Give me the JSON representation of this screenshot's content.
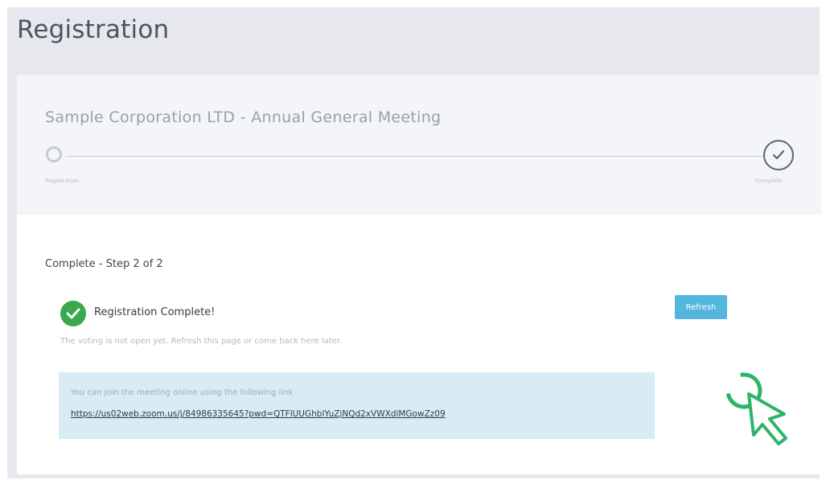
{
  "page": {
    "title": "Registration"
  },
  "meeting": {
    "title": "Sample Corporation LTD - Annual General Meeting"
  },
  "stepper": {
    "steps": [
      {
        "label": "Registration",
        "state": "inactive"
      },
      {
        "label": "Complete",
        "state": "active"
      }
    ]
  },
  "status": {
    "step_text": "Complete - Step 2 of 2",
    "complete_title": "Registration Complete!",
    "voting_note": "The voting is not open yet. Refresh this page or come back here later."
  },
  "refresh_button": {
    "label": "Refresh"
  },
  "info_box": {
    "text": "You can join the meeting online using the following link",
    "link": "https://us02web.zoom.us/j/84986335645?pwd=QTFlUUGhblYuZjNQd2xVWXdlMGowZz09"
  },
  "colors": {
    "accent_button": "#54b6dd",
    "success_green": "#39a84e",
    "cursor_green": "#2db36a",
    "info_background": "#d9ebf4"
  },
  "icons": {
    "complete_step": "checkmark-circle-icon",
    "success": "check-icon",
    "cursor": "pointer-cursor-icon"
  }
}
